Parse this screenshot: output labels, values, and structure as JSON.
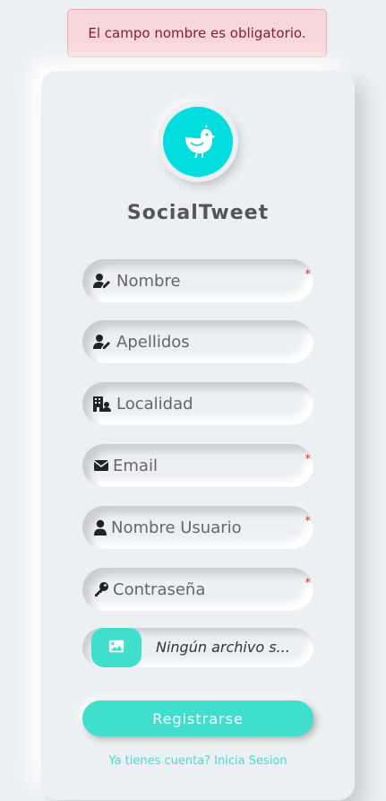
{
  "alert": {
    "message": "El campo nombre es obligatorio."
  },
  "brand": {
    "name": "SocialTweet",
    "logo_icon": "bird-icon",
    "logo_color": "#04dde0"
  },
  "form": {
    "fields": [
      {
        "placeholder": "Nombre",
        "icon": "user-edit-icon",
        "required_mark": "*"
      },
      {
        "placeholder": "Apellidos",
        "icon": "user-edit-icon",
        "required_mark": ""
      },
      {
        "placeholder": "Localidad",
        "icon": "building-icon",
        "required_mark": ""
      },
      {
        "placeholder": "Email",
        "icon": "envelope-icon",
        "required_mark": "*"
      },
      {
        "placeholder": "Nombre Usuario",
        "icon": "user-icon",
        "required_mark": "*"
      },
      {
        "placeholder": "Contraseña",
        "icon": "key-icon",
        "required_mark": "*"
      }
    ],
    "file": {
      "icon": "image-icon",
      "label": "Ningún archivo s..."
    },
    "submit_label": "Registrarse",
    "login_link": "Ya tienes cuenta? Inicia Sesion"
  },
  "colors": {
    "accent": "#40dfcd",
    "alert_bg": "#f8d7da",
    "alert_text": "#842029",
    "required": "#e03131"
  }
}
